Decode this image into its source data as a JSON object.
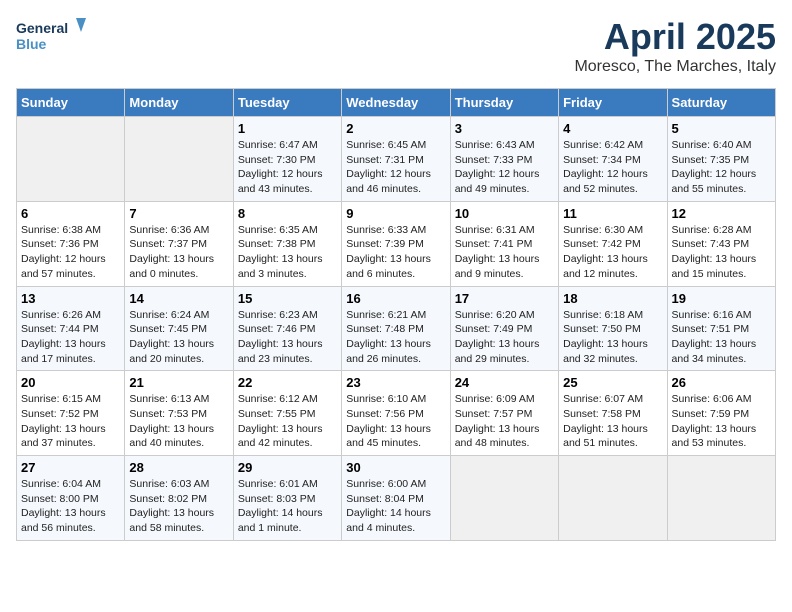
{
  "logo": {
    "line1": "General",
    "line2": "Blue"
  },
  "title": "April 2025",
  "subtitle": "Moresco, The Marches, Italy",
  "days_of_week": [
    "Sunday",
    "Monday",
    "Tuesday",
    "Wednesday",
    "Thursday",
    "Friday",
    "Saturday"
  ],
  "weeks": [
    [
      {
        "day": "",
        "content": ""
      },
      {
        "day": "",
        "content": ""
      },
      {
        "day": "1",
        "content": "Sunrise: 6:47 AM\nSunset: 7:30 PM\nDaylight: 12 hours and 43 minutes."
      },
      {
        "day": "2",
        "content": "Sunrise: 6:45 AM\nSunset: 7:31 PM\nDaylight: 12 hours and 46 minutes."
      },
      {
        "day": "3",
        "content": "Sunrise: 6:43 AM\nSunset: 7:33 PM\nDaylight: 12 hours and 49 minutes."
      },
      {
        "day": "4",
        "content": "Sunrise: 6:42 AM\nSunset: 7:34 PM\nDaylight: 12 hours and 52 minutes."
      },
      {
        "day": "5",
        "content": "Sunrise: 6:40 AM\nSunset: 7:35 PM\nDaylight: 12 hours and 55 minutes."
      }
    ],
    [
      {
        "day": "6",
        "content": "Sunrise: 6:38 AM\nSunset: 7:36 PM\nDaylight: 12 hours and 57 minutes."
      },
      {
        "day": "7",
        "content": "Sunrise: 6:36 AM\nSunset: 7:37 PM\nDaylight: 13 hours and 0 minutes."
      },
      {
        "day": "8",
        "content": "Sunrise: 6:35 AM\nSunset: 7:38 PM\nDaylight: 13 hours and 3 minutes."
      },
      {
        "day": "9",
        "content": "Sunrise: 6:33 AM\nSunset: 7:39 PM\nDaylight: 13 hours and 6 minutes."
      },
      {
        "day": "10",
        "content": "Sunrise: 6:31 AM\nSunset: 7:41 PM\nDaylight: 13 hours and 9 minutes."
      },
      {
        "day": "11",
        "content": "Sunrise: 6:30 AM\nSunset: 7:42 PM\nDaylight: 13 hours and 12 minutes."
      },
      {
        "day": "12",
        "content": "Sunrise: 6:28 AM\nSunset: 7:43 PM\nDaylight: 13 hours and 15 minutes."
      }
    ],
    [
      {
        "day": "13",
        "content": "Sunrise: 6:26 AM\nSunset: 7:44 PM\nDaylight: 13 hours and 17 minutes."
      },
      {
        "day": "14",
        "content": "Sunrise: 6:24 AM\nSunset: 7:45 PM\nDaylight: 13 hours and 20 minutes."
      },
      {
        "day": "15",
        "content": "Sunrise: 6:23 AM\nSunset: 7:46 PM\nDaylight: 13 hours and 23 minutes."
      },
      {
        "day": "16",
        "content": "Sunrise: 6:21 AM\nSunset: 7:48 PM\nDaylight: 13 hours and 26 minutes."
      },
      {
        "day": "17",
        "content": "Sunrise: 6:20 AM\nSunset: 7:49 PM\nDaylight: 13 hours and 29 minutes."
      },
      {
        "day": "18",
        "content": "Sunrise: 6:18 AM\nSunset: 7:50 PM\nDaylight: 13 hours and 32 minutes."
      },
      {
        "day": "19",
        "content": "Sunrise: 6:16 AM\nSunset: 7:51 PM\nDaylight: 13 hours and 34 minutes."
      }
    ],
    [
      {
        "day": "20",
        "content": "Sunrise: 6:15 AM\nSunset: 7:52 PM\nDaylight: 13 hours and 37 minutes."
      },
      {
        "day": "21",
        "content": "Sunrise: 6:13 AM\nSunset: 7:53 PM\nDaylight: 13 hours and 40 minutes."
      },
      {
        "day": "22",
        "content": "Sunrise: 6:12 AM\nSunset: 7:55 PM\nDaylight: 13 hours and 42 minutes."
      },
      {
        "day": "23",
        "content": "Sunrise: 6:10 AM\nSunset: 7:56 PM\nDaylight: 13 hours and 45 minutes."
      },
      {
        "day": "24",
        "content": "Sunrise: 6:09 AM\nSunset: 7:57 PM\nDaylight: 13 hours and 48 minutes."
      },
      {
        "day": "25",
        "content": "Sunrise: 6:07 AM\nSunset: 7:58 PM\nDaylight: 13 hours and 51 minutes."
      },
      {
        "day": "26",
        "content": "Sunrise: 6:06 AM\nSunset: 7:59 PM\nDaylight: 13 hours and 53 minutes."
      }
    ],
    [
      {
        "day": "27",
        "content": "Sunrise: 6:04 AM\nSunset: 8:00 PM\nDaylight: 13 hours and 56 minutes."
      },
      {
        "day": "28",
        "content": "Sunrise: 6:03 AM\nSunset: 8:02 PM\nDaylight: 13 hours and 58 minutes."
      },
      {
        "day": "29",
        "content": "Sunrise: 6:01 AM\nSunset: 8:03 PM\nDaylight: 14 hours and 1 minute."
      },
      {
        "day": "30",
        "content": "Sunrise: 6:00 AM\nSunset: 8:04 PM\nDaylight: 14 hours and 4 minutes."
      },
      {
        "day": "",
        "content": ""
      },
      {
        "day": "",
        "content": ""
      },
      {
        "day": "",
        "content": ""
      }
    ]
  ]
}
